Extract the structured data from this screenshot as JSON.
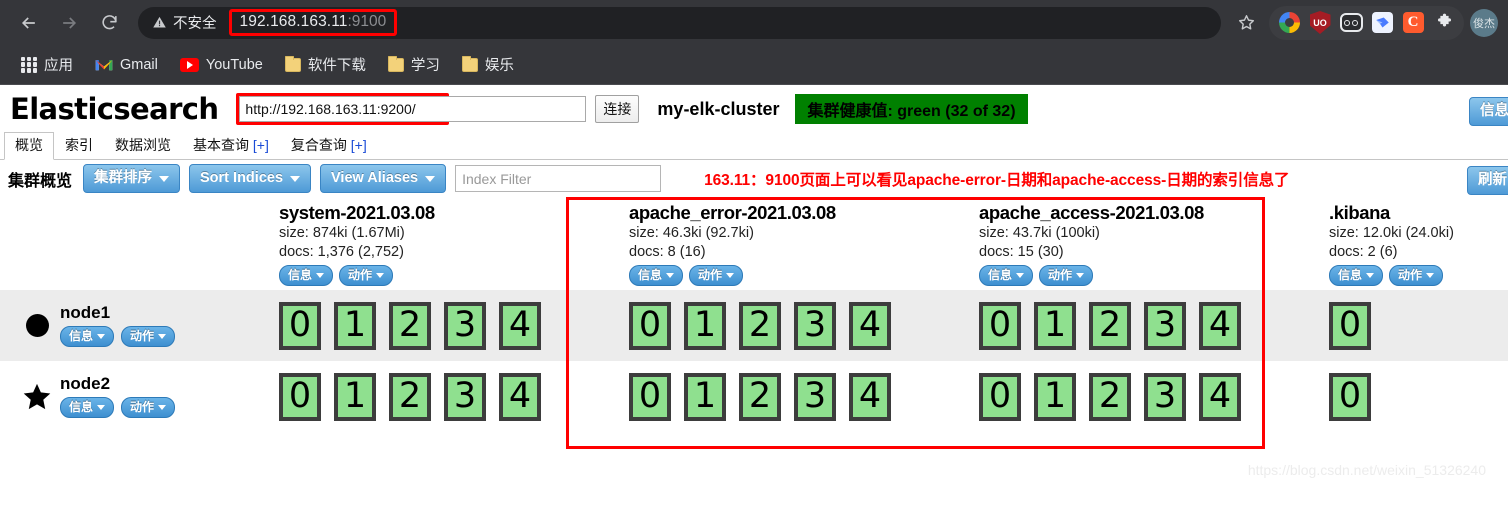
{
  "browser": {
    "back_icon": "back-arrow-icon",
    "forward_icon": "forward-arrow-icon",
    "reload_icon": "reload-icon",
    "security_label": "不安全",
    "url_main": "192.168.163.11",
    "url_port": ":9100",
    "bookmark_star_icon": "star-icon",
    "extensions": [
      {
        "name": "chrome-ring-extension-icon",
        "label": ""
      },
      {
        "name": "ublock-shield-extension-icon",
        "label": "UO"
      },
      {
        "name": "goggles-extension-icon",
        "label": ""
      },
      {
        "name": "bird-extension-icon",
        "label": ""
      },
      {
        "name": "c-extension-icon",
        "label": "C"
      },
      {
        "name": "puzzle-extensions-icon",
        "label": ""
      }
    ],
    "profile_label": "俊杰"
  },
  "bookmarks": [
    {
      "label": "应用",
      "icon": "apps-grid-icon"
    },
    {
      "label": "Gmail",
      "icon": "gmail-icon"
    },
    {
      "label": "YouTube",
      "icon": "youtube-icon"
    },
    {
      "label": "软件下载",
      "icon": "folder-icon"
    },
    {
      "label": "学习",
      "icon": "folder-icon"
    },
    {
      "label": "娱乐",
      "icon": "folder-icon"
    }
  ],
  "es": {
    "logo": "Elasticsearch",
    "url_value": "http://192.168.163.11:9200/",
    "url_placeholder": "http://192.168.163.11:9200/",
    "connect_label": "连接",
    "cluster_name": "my-elk-cluster",
    "health_badge": "集群健康值: green (32 of 32)",
    "header_info_label": "信息",
    "tabs": [
      {
        "label": "概览",
        "active": true
      },
      {
        "label": "索引",
        "active": false
      },
      {
        "label": "数据浏览",
        "active": false
      },
      {
        "label": "基本查询",
        "plus": " [+]",
        "active": false
      },
      {
        "label": "复合查询",
        "plus": " [+]",
        "active": false
      }
    ],
    "toolbar": {
      "title": "集群概览",
      "sort_cluster_label": "集群排序",
      "sort_indices_label": "Sort Indices",
      "view_aliases_label": "View Aliases",
      "index_filter_placeholder": "Index Filter",
      "refresh_label": "刷新"
    },
    "annotation": "163.11：9100页面上可以看见apache-error-日期和apache-access-日期的索引信息了",
    "info_label": "信息",
    "action_label": "动作",
    "indices": [
      {
        "name": "system-2021.03.08",
        "size": "size: 874ki (1.67Mi)",
        "docs": "docs: 1,376 (2,752)",
        "shards": [
          "0",
          "1",
          "2",
          "3",
          "4"
        ]
      },
      {
        "name": "apache_error-2021.03.08",
        "size": "size: 46.3ki (92.7ki)",
        "docs": "docs: 8 (16)",
        "shards": [
          "0",
          "1",
          "2",
          "3",
          "4"
        ]
      },
      {
        "name": "apache_access-2021.03.08",
        "size": "size: 43.7ki (100ki)",
        "docs": "docs: 15 (30)",
        "shards": [
          "0",
          "1",
          "2",
          "3",
          "4"
        ]
      },
      {
        "name": ".kibana",
        "size": "size: 12.0ki (24.0ki)",
        "docs": "docs: 2 (6)",
        "shards": [
          "0"
        ]
      }
    ],
    "nodes": [
      {
        "name": "node1",
        "marker": "circle-icon"
      },
      {
        "name": "node2",
        "marker": "star-icon"
      }
    ]
  },
  "watermark": "https://blog.csdn.net/weixin_51326240"
}
